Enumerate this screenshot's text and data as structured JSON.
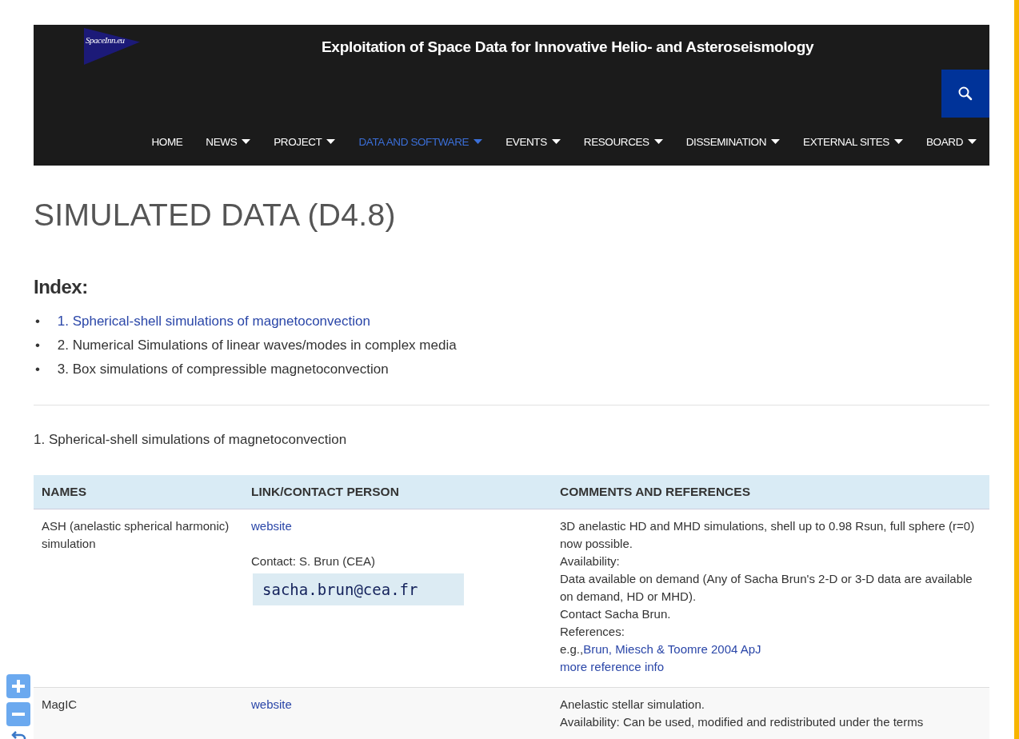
{
  "header": {
    "logo_text": "SpaceInn.eu",
    "title": "Exploitation of Space Data for Innovative Helio- and Asteroseismology"
  },
  "nav": [
    {
      "label": "HOME",
      "dropdown": false,
      "selected": false
    },
    {
      "label": "NEWS",
      "dropdown": true,
      "selected": false
    },
    {
      "label": "PROJECT",
      "dropdown": true,
      "selected": false
    },
    {
      "label": "DATA AND SOFTWARE",
      "dropdown": true,
      "selected": true
    },
    {
      "label": "EVENTS",
      "dropdown": true,
      "selected": false
    },
    {
      "label": "RESOURCES",
      "dropdown": true,
      "selected": false
    },
    {
      "label": "DISSEMINATION",
      "dropdown": true,
      "selected": false
    },
    {
      "label": "EXTERNAL SITES",
      "dropdown": true,
      "selected": false
    },
    {
      "label": "BOARD",
      "dropdown": true,
      "selected": false
    }
  ],
  "page_title": "SIMULATED DATA (D4.8)",
  "index": {
    "heading": "Index:",
    "items": [
      {
        "bullet": "•",
        "text": "1. Spherical-shell simulations of magnetoconvection",
        "kind": "link"
      },
      {
        "bullet": "•",
        "text": "2. Numerical Simulations of linear waves/modes in complex media",
        "kind": "text"
      },
      {
        "bullet": "•",
        "text": "3. Box simulations of compressible magnetoconvection",
        "kind": "text"
      }
    ]
  },
  "section_title": "1. Spherical-shell simulations of magnetoconvection",
  "table": {
    "columns": [
      "NAMES",
      "LINK/CONTACT PERSON",
      "COMMENTS AND REFERENCES"
    ],
    "rows": [
      {
        "name": "ASH (anelastic spherical harmonic) simulation",
        "link": "website",
        "contact": "Contact: S. Brun (CEA)",
        "email": "sacha.brun@cea.fr",
        "comments": [
          {
            "kind": "text",
            "text": "3D anelastic HD and MHD simulations, shell up to 0.98 Rsun, full sphere (r=0) now possible."
          },
          {
            "kind": "text",
            "text": "Availability:"
          },
          {
            "kind": "text",
            "text": "Data available on demand (Any of Sacha Brun's 2-D or 3-D data are available on demand, HD or MHD)."
          },
          {
            "kind": "text",
            "text": "Contact Sacha Brun."
          },
          {
            "kind": "text",
            "text": "References:"
          },
          {
            "kind": "reference",
            "prefix": "e.g.,",
            "link": "Brun, Miesch & Toomre 2004 ApJ"
          },
          {
            "kind": "link",
            "text": "more reference info"
          }
        ]
      },
      {
        "name": "MagIC",
        "link": "website",
        "comments": [
          {
            "kind": "text",
            "text": "Anelastic stellar simulation."
          },
          {
            "kind": "text",
            "text": "Availability: Can be used, modified and redistributed under the terms"
          }
        ]
      }
    ]
  }
}
